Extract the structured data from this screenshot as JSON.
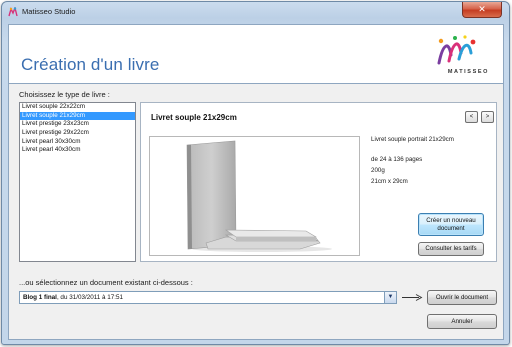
{
  "window": {
    "title": "Matisseo Studio",
    "close_glyph": "✕"
  },
  "header": {
    "title": "Création d'un livre",
    "logo_text": "MATISSEO"
  },
  "book_type": {
    "label": "Choisissez le type de livre :",
    "items": [
      "Livret souple 22x22cm",
      "Livret souple 21x29cm",
      "Livret prestige 23x23cm",
      "Livret prestige 29x22cm",
      "Livret pearl 30x30cm",
      "Livret pearl 40x30cm"
    ],
    "selected_index": 1
  },
  "detail": {
    "title": "Livret souple 21x29cm",
    "prev_glyph": "<",
    "next_glyph": ">",
    "description": "Livret souple portrait 21x29cm",
    "pages": "de 24 à 136 pages",
    "paper": "200g",
    "size": "21cm x 29cm",
    "create_button": "Créer un nouveau document",
    "tarifs_button": "Consulter les tarifs"
  },
  "existing": {
    "label": "...ou sélectionnez un document existant ci-dessous :",
    "selected_name": "Blog 1 final",
    "selected_suffix": ", du 31/03/2011 à 17:51",
    "dropdown_glyph": "▼",
    "open_button": "Ouvrir le document",
    "cancel_button": "Annuler"
  },
  "colors": {
    "accent_title": "#3a6eb0",
    "selection": "#3399ff"
  }
}
